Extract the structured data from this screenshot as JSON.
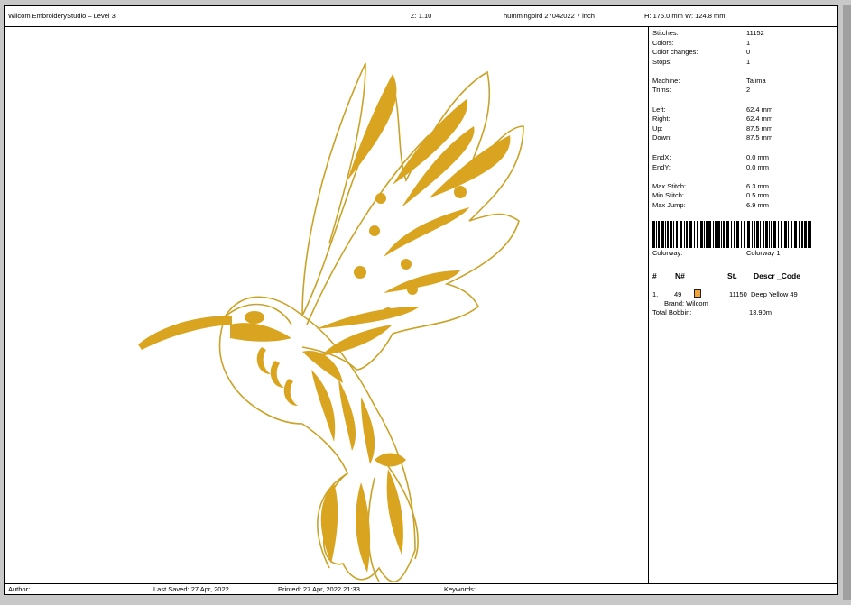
{
  "header": {
    "app_title": "Wilcom EmbroideryStudio – Level 3",
    "zoom": "Z: 1.10",
    "design_name": "hummingbird 27042022 7 inch",
    "size": "H: 175.0 mm   W: 124.8 mm"
  },
  "stats": [
    {
      "label": "Stitches:",
      "value": "11152"
    },
    {
      "label": "Colors:",
      "value": "1"
    },
    {
      "label": "Color changes:",
      "value": "0"
    },
    {
      "label": "Stops:",
      "value": "1"
    },
    {
      "label": "Machine:",
      "value": "Tajima"
    },
    {
      "label": "Trims:",
      "value": "2"
    },
    {
      "label": "Left:",
      "value": "62.4 mm"
    },
    {
      "label": "Right:",
      "value": "62.4 mm"
    },
    {
      "label": "Up:",
      "value": "87.5 mm"
    },
    {
      "label": "Down:",
      "value": "87.5 mm"
    },
    {
      "label": "EndX:",
      "value": "0.0 mm"
    },
    {
      "label": "EndY:",
      "value": "0.0 mm"
    },
    {
      "label": "Max Stitch:",
      "value": "6.3 mm"
    },
    {
      "label": "Min Stitch:",
      "value": "0.5 mm"
    },
    {
      "label": "Max Jump:",
      "value": "6.9 mm"
    }
  ],
  "colorway": {
    "label": "Colorway:",
    "value": "Colorway 1"
  },
  "color_table": {
    "headers": {
      "num": "#",
      "n": "N#",
      "st": "St.",
      "descr": "Descr _Code"
    },
    "rows": [
      {
        "num": "1.",
        "n": "49",
        "swatch": "#f0a53c",
        "st": "11150",
        "descr": "Deep Yellow 49",
        "brand": "Brand: Wilcom"
      }
    ],
    "total_bobbin_label": "Total Bobbin:",
    "total_bobbin_value": "13.90m"
  },
  "footer": {
    "author": "Author:",
    "last_saved": "Last Saved: 27 Apr, 2022",
    "printed": "Printed: 27 Apr, 2022 21:33",
    "keywords": "Keywords:"
  },
  "colors": {
    "thread": "#d9a520",
    "thread_dark": "#b8860b",
    "outline": "#c9a227"
  }
}
